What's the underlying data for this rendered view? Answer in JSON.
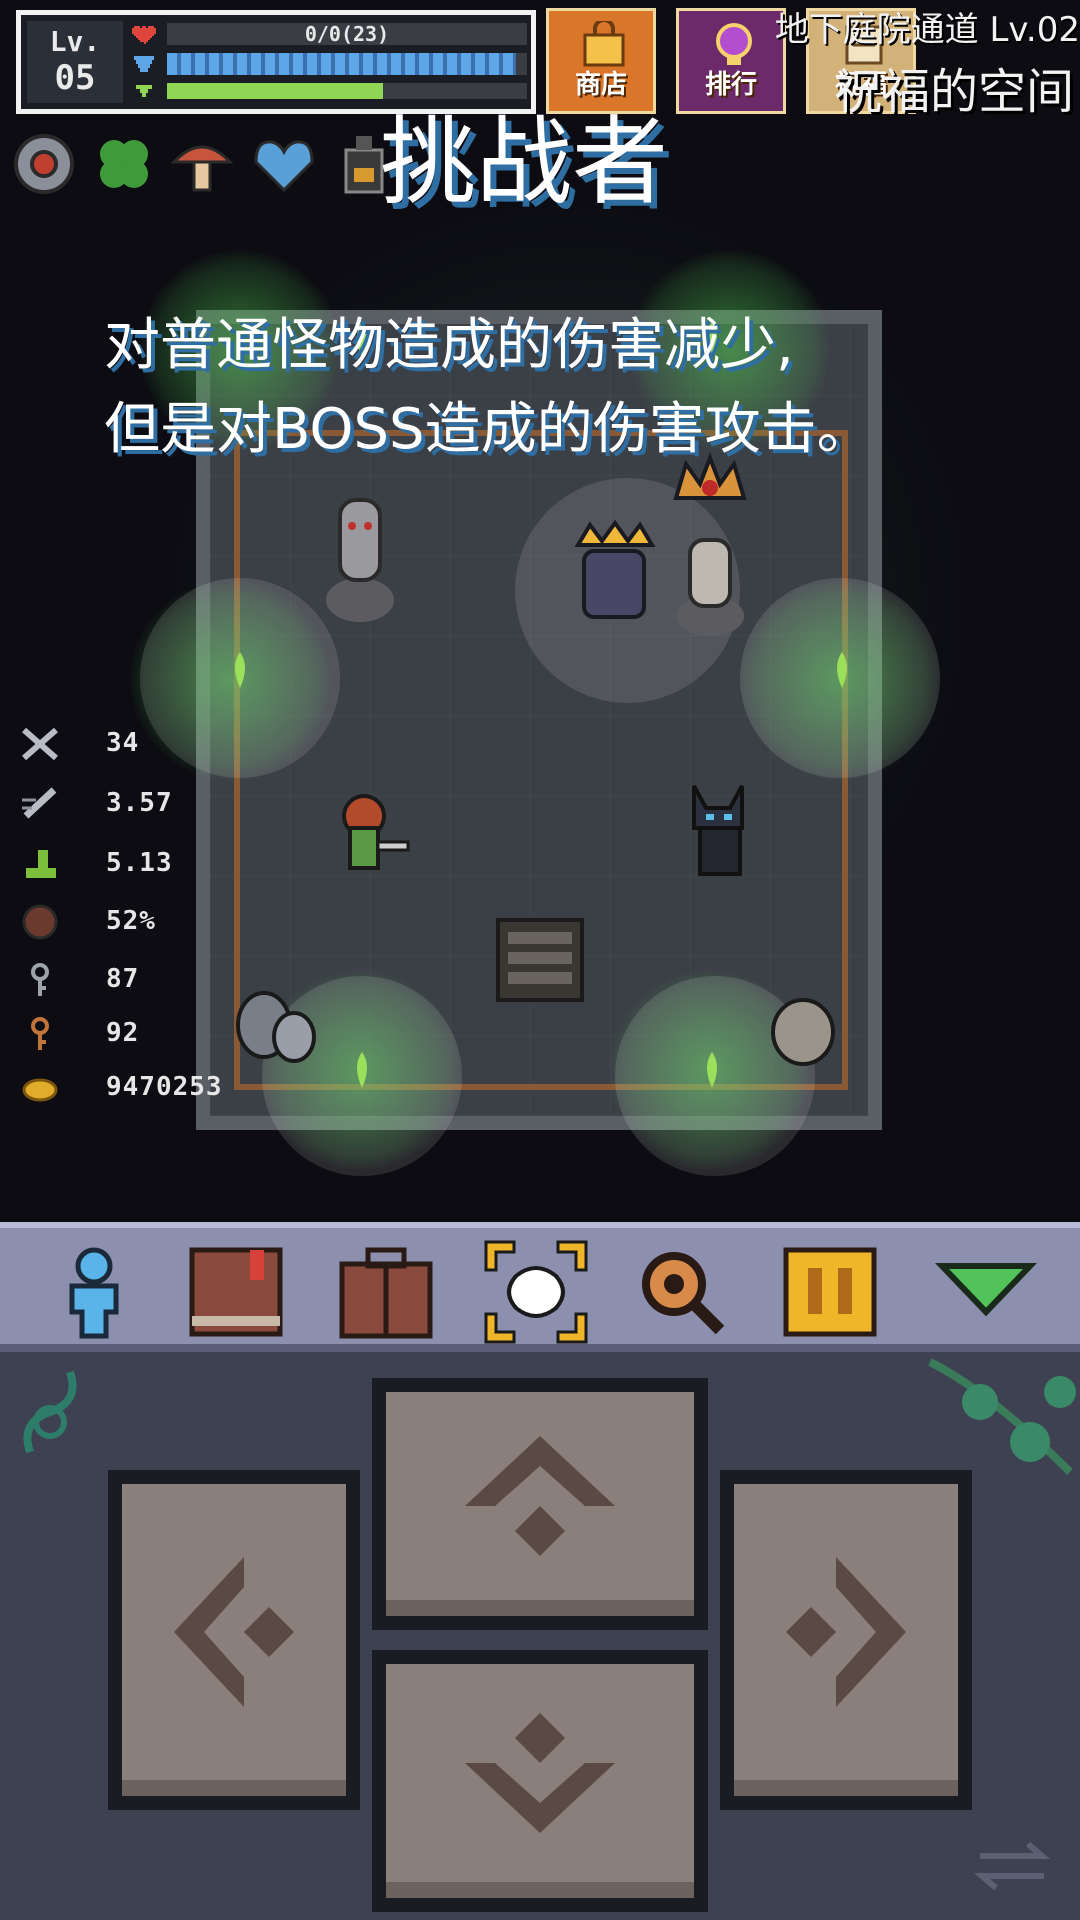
{
  "hud": {
    "level_label": "Lv.",
    "level_value": "05",
    "hp_text": "0/0(23)",
    "mp_fill": 0.97,
    "xp_fill": 0.6
  },
  "top_buttons": {
    "shop": "商店",
    "rank": "排行",
    "bless": "祝福"
  },
  "location": {
    "title": "地下庭院通道 Lv.02",
    "subtitle": "祝福的空间"
  },
  "buff": {
    "title": "挑战者",
    "desc_line1": "对普通怪物造成的伤害减少,",
    "desc_line2": "但是对BOSS造成的伤害攻击。"
  },
  "stats": [
    {
      "icon": "crossed-swords-icon",
      "value": "34"
    },
    {
      "icon": "sword-speed-icon",
      "value": "3.57"
    },
    {
      "icon": "boot-icon",
      "value": "5.13"
    },
    {
      "icon": "shield-icon",
      "value": "52%"
    },
    {
      "icon": "silver-key-icon",
      "value": "87"
    },
    {
      "icon": "bronze-key-icon",
      "value": "92"
    },
    {
      "icon": "gold-coin-icon",
      "value": "9470253"
    }
  ],
  "colors": {
    "accent_blue": "#2e6ea2",
    "hp_red": "#e0453c",
    "mp_blue": "#5da7e8",
    "xp_green": "#8fd657",
    "toolbar": "#8c8fae"
  }
}
